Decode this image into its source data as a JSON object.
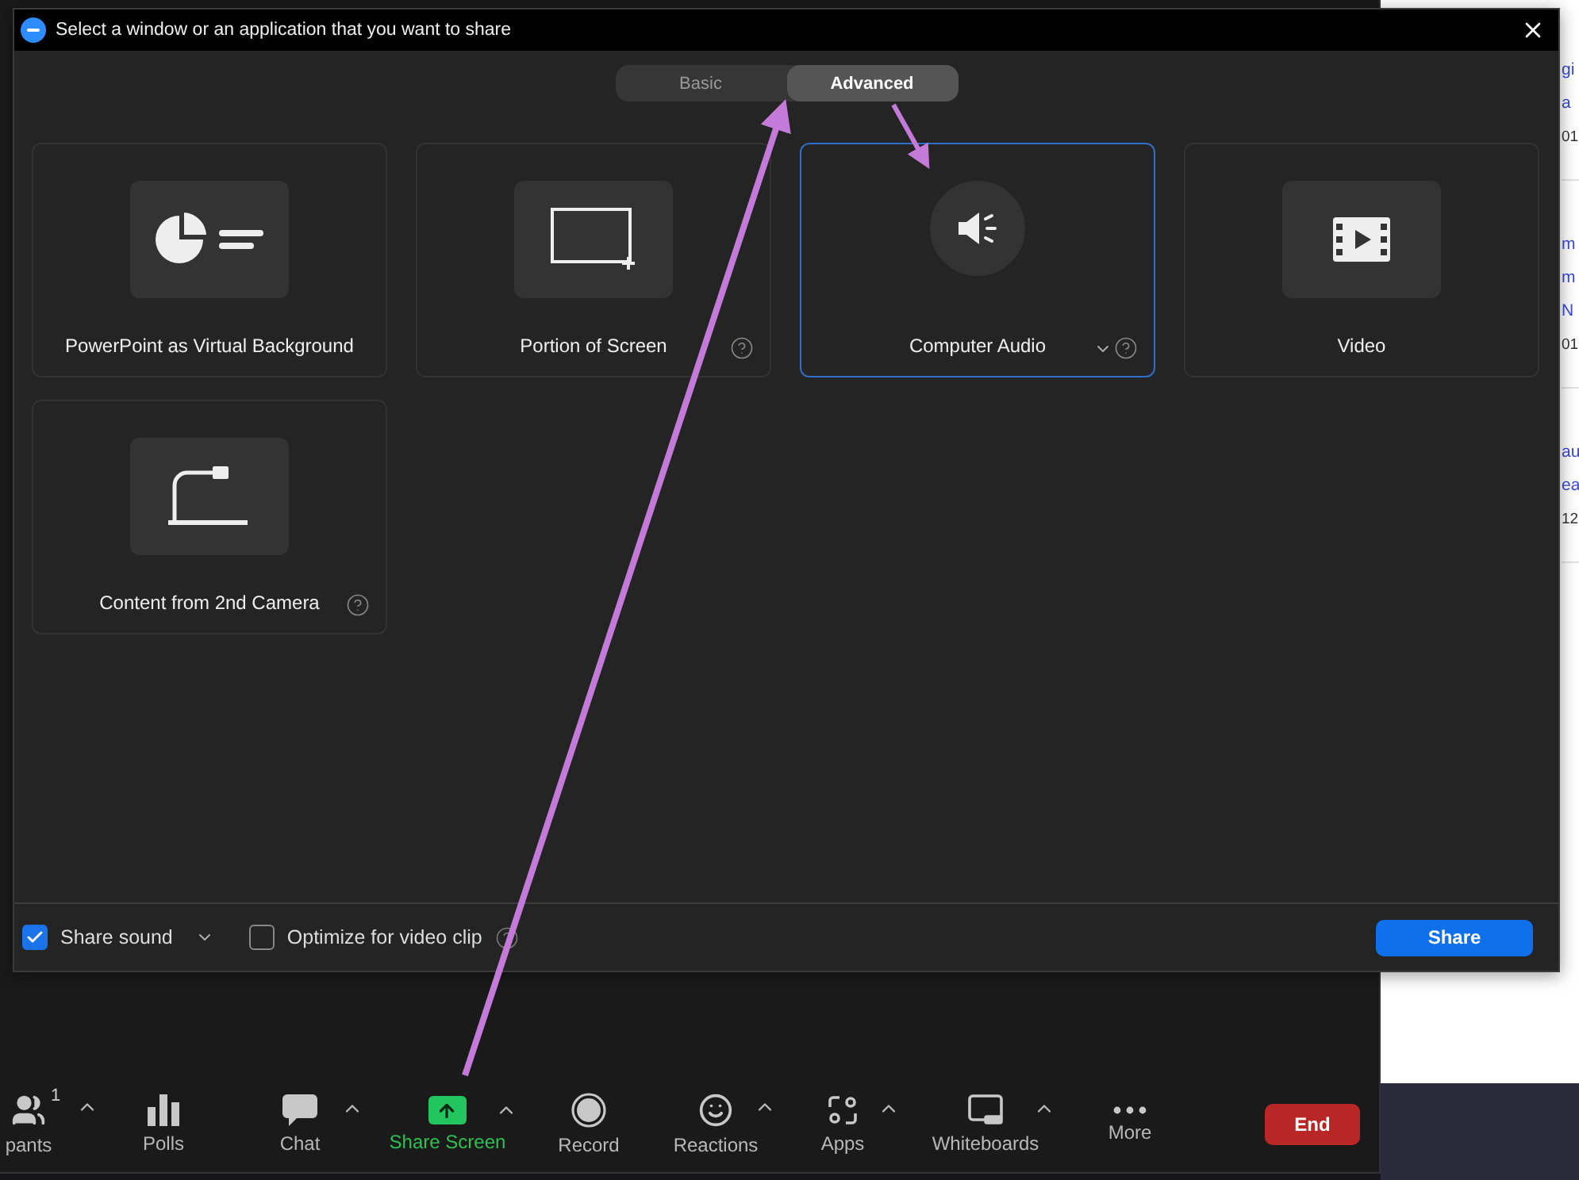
{
  "dialog": {
    "title": "Select a window or an application that you want to share",
    "tabs": [
      {
        "label": "Basic",
        "selected": false
      },
      {
        "label": "Advanced",
        "selected": true
      }
    ],
    "options": [
      {
        "label": "PowerPoint as Virtual Background",
        "kind": "powerpoint",
        "selected": false,
        "help": false,
        "dropdown": false
      },
      {
        "label": "Portion of Screen",
        "kind": "portion",
        "selected": false,
        "help": true,
        "dropdown": false
      },
      {
        "label": "Computer Audio",
        "kind": "audio",
        "selected": true,
        "help": true,
        "dropdown": true
      },
      {
        "label": "Video",
        "kind": "video",
        "selected": false,
        "help": false,
        "dropdown": false
      },
      {
        "label": "Content from 2nd Camera",
        "kind": "camera",
        "selected": false,
        "help": true,
        "dropdown": false
      }
    ],
    "footer": {
      "checkboxes": [
        {
          "label": "Share sound",
          "checked": true,
          "dropdown": true,
          "help": false
        },
        {
          "label": "Optimize for video clip",
          "checked": false,
          "dropdown": false,
          "help": true
        }
      ],
      "share_button": "Share"
    }
  },
  "meeting_toolbar": {
    "items": [
      {
        "label": "pants",
        "kind": "participants",
        "count": "1",
        "caret": true,
        "active": false
      },
      {
        "label": "Polls",
        "kind": "polls",
        "caret": false,
        "active": false
      },
      {
        "label": "Chat",
        "kind": "chat",
        "caret": true,
        "active": false
      },
      {
        "label": "Share Screen",
        "kind": "share",
        "caret": true,
        "active": true
      },
      {
        "label": "Record",
        "kind": "record",
        "caret": false,
        "active": false
      },
      {
        "label": "Reactions",
        "kind": "reactions",
        "caret": true,
        "active": false
      },
      {
        "label": "Apps",
        "kind": "apps",
        "caret": true,
        "active": false
      },
      {
        "label": "Whiteboards",
        "kind": "whiteboard",
        "caret": true,
        "active": false
      },
      {
        "label": "More",
        "kind": "more",
        "caret": false,
        "active": false
      }
    ],
    "end_button": "End"
  },
  "background_page": {
    "entries": [
      {
        "lines": [
          {
            "text": "gi",
            "kind": "link"
          },
          {
            "text": "a",
            "kind": "link"
          },
          {
            "text": "01",
            "kind": "meta"
          }
        ]
      },
      {
        "lines": [
          {
            "text": "m",
            "kind": "link"
          },
          {
            "text": "m",
            "kind": "link"
          },
          {
            "text": "N",
            "kind": "link"
          },
          {
            "text": "01",
            "kind": "meta"
          }
        ]
      },
      {
        "lines": [
          {
            "text": "au",
            "kind": "link"
          },
          {
            "text": "ea",
            "kind": "link"
          },
          {
            "text": "12",
            "kind": "meta"
          }
        ]
      }
    ]
  }
}
